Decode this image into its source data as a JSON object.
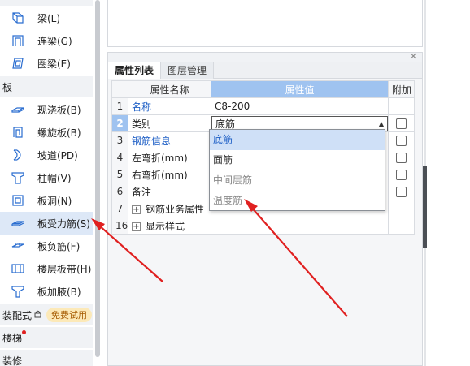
{
  "left_panel": {
    "items_beam": [
      {
        "label": "梁(L)",
        "icon": "beam-icon"
      },
      {
        "label": "连梁(G)",
        "icon": "coupling-beam-icon"
      },
      {
        "label": "圈梁(E)",
        "icon": "ring-beam-icon"
      }
    ],
    "category_slab": "板",
    "items_slab": [
      {
        "label": "现浇板(B)",
        "icon": "cast-slab-icon"
      },
      {
        "label": "螺旋板(B)",
        "icon": "spiral-slab-icon"
      },
      {
        "label": "坡道(PD)",
        "icon": "ramp-icon"
      },
      {
        "label": "柱帽(V)",
        "icon": "column-cap-icon"
      },
      {
        "label": "板洞(N)",
        "icon": "slab-hole-icon"
      },
      {
        "label": "板受力筋(S)",
        "icon": "slab-stress-rebar-icon"
      },
      {
        "label": "板负筋(F)",
        "icon": "slab-negative-rebar-icon"
      },
      {
        "label": "楼层板带(H)",
        "icon": "floor-slab-strip-icon"
      },
      {
        "label": "板加腋(B)",
        "icon": "slab-haunch-icon"
      }
    ],
    "category_prefab": "装配式",
    "prefab_badge": "免费试用",
    "category_stairs": "楼梯",
    "category_decoration": "装修"
  },
  "properties": {
    "tabs": [
      "属性列表",
      "图层管理"
    ],
    "headers": {
      "name": "属性名称",
      "value": "属性值",
      "extra": "附加"
    },
    "rows": [
      {
        "idx": "1",
        "name": "名称",
        "value": "C8-200",
        "checkbox": false
      },
      {
        "idx": "2",
        "name": "类别",
        "value": "底筋",
        "checkbox": true
      },
      {
        "idx": "3",
        "name": "钢筋信息",
        "value": "",
        "checkbox": true
      },
      {
        "idx": "4",
        "name": "左弯折(mm)",
        "value": "",
        "checkbox": true
      },
      {
        "idx": "5",
        "name": "右弯折(mm)",
        "value": "",
        "checkbox": true
      },
      {
        "idx": "6",
        "name": "备注",
        "value": "",
        "checkbox": true
      },
      {
        "idx": "7",
        "name": "钢筋业务属性",
        "value": "",
        "checkbox": false
      },
      {
        "idx": "16",
        "name": "显示样式",
        "value": "",
        "checkbox": false
      }
    ],
    "dropdown_options": [
      "底筋",
      "面筋",
      "中间层筋",
      "温度筋"
    ]
  },
  "colors": {
    "accent_blue": "#9fc3f0",
    "link_blue": "#1e5fc6",
    "arrow_red": "#e02020",
    "selected_bg": "#dde8f7"
  }
}
